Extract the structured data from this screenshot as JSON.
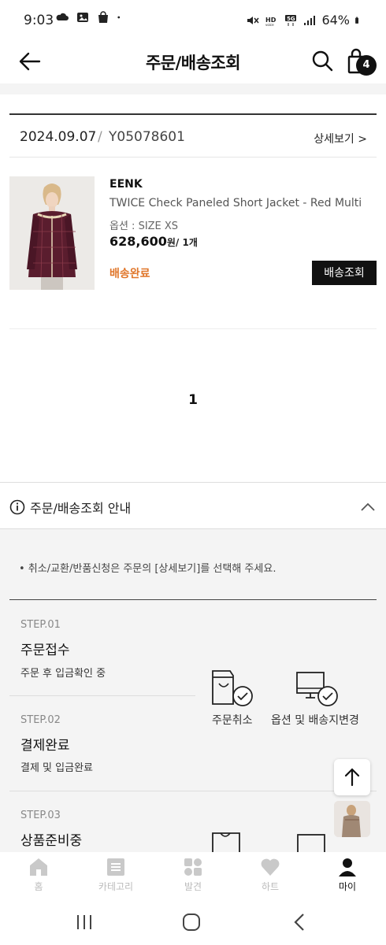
{
  "status_bar": {
    "time": "9:03",
    "left_icons": [
      "cloud-icon",
      "image-icon",
      "shopping-bag-icon",
      "dot-icon"
    ],
    "right_icons": [
      "mute-icon",
      "hd-voice-icon",
      "5g-icon",
      "signal-icon"
    ],
    "battery": "64%"
  },
  "header": {
    "title": "주문/배송조회",
    "cart_count": "4"
  },
  "order": {
    "date": "2024.09.07",
    "separator": "/",
    "order_no": "Y05078601",
    "detail_link": "상세보기 >"
  },
  "product": {
    "brand": "EENK",
    "name": "TWICE Check Paneled Short Jacket - Red Multi",
    "option": "옵션 : SIZE XS",
    "price": "628,600",
    "price_unit": "원/ 1개",
    "status": "배송완료",
    "track_button": "배송조회"
  },
  "pagination": {
    "current_page": "1"
  },
  "guide": {
    "title": "주문/배송조회 안내",
    "note": "• 취소/교환/반품신청은 주문의 [상세보기]를 선택해 주세요.",
    "steps": [
      {
        "label": "STEP.01",
        "title": "주문접수",
        "desc": "주문 후 입금확인 중"
      },
      {
        "label": "STEP.02",
        "title": "결제완료",
        "desc": "결제 및 입금완료"
      },
      {
        "label": "STEP.03",
        "title": "상품준비중",
        "desc": ""
      }
    ],
    "actions": [
      {
        "label": "주문취소",
        "icon": "bag-check-icon"
      },
      {
        "label": "옵션 및 배송지변경",
        "icon": "monitor-check-icon"
      }
    ]
  },
  "tabbar": {
    "items": [
      {
        "label": "홈",
        "icon": "home-icon"
      },
      {
        "label": "카테고리",
        "icon": "category-icon"
      },
      {
        "label": "발견",
        "icon": "discover-icon"
      },
      {
        "label": "하트",
        "icon": "heart-icon"
      },
      {
        "label": "마이",
        "icon": "person-icon",
        "active": true
      }
    ]
  },
  "colors": {
    "accent_status": "#e0762a",
    "primary": "#111111",
    "guide_background": "#f4f4f4"
  }
}
